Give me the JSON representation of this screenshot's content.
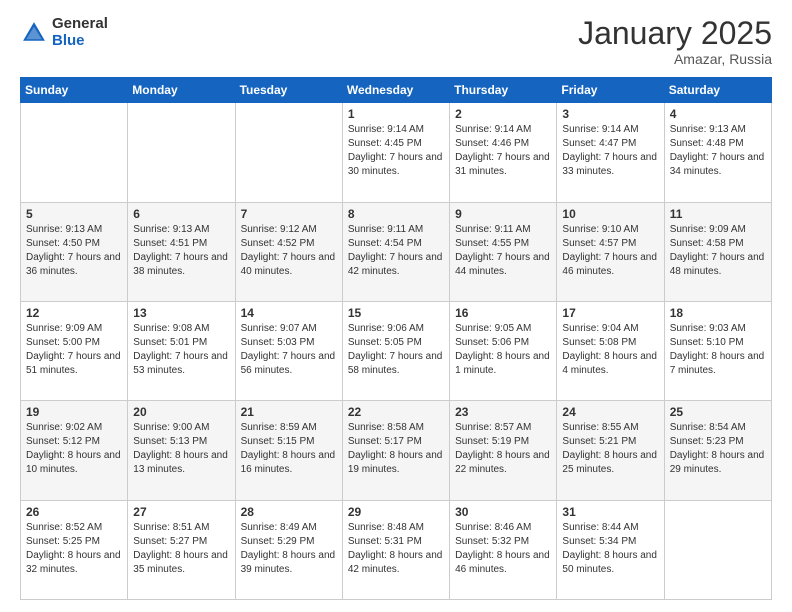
{
  "logo": {
    "general": "General",
    "blue": "Blue"
  },
  "header": {
    "month": "January 2025",
    "location": "Amazar, Russia"
  },
  "weekdays": [
    "Sunday",
    "Monday",
    "Tuesday",
    "Wednesday",
    "Thursday",
    "Friday",
    "Saturday"
  ],
  "weeks": [
    [
      {
        "day": "",
        "info": ""
      },
      {
        "day": "",
        "info": ""
      },
      {
        "day": "",
        "info": ""
      },
      {
        "day": "1",
        "info": "Sunrise: 9:14 AM\nSunset: 4:45 PM\nDaylight: 7 hours\nand 30 minutes."
      },
      {
        "day": "2",
        "info": "Sunrise: 9:14 AM\nSunset: 4:46 PM\nDaylight: 7 hours\nand 31 minutes."
      },
      {
        "day": "3",
        "info": "Sunrise: 9:14 AM\nSunset: 4:47 PM\nDaylight: 7 hours\nand 33 minutes."
      },
      {
        "day": "4",
        "info": "Sunrise: 9:13 AM\nSunset: 4:48 PM\nDaylight: 7 hours\nand 34 minutes."
      }
    ],
    [
      {
        "day": "5",
        "info": "Sunrise: 9:13 AM\nSunset: 4:50 PM\nDaylight: 7 hours\nand 36 minutes."
      },
      {
        "day": "6",
        "info": "Sunrise: 9:13 AM\nSunset: 4:51 PM\nDaylight: 7 hours\nand 38 minutes."
      },
      {
        "day": "7",
        "info": "Sunrise: 9:12 AM\nSunset: 4:52 PM\nDaylight: 7 hours\nand 40 minutes."
      },
      {
        "day": "8",
        "info": "Sunrise: 9:11 AM\nSunset: 4:54 PM\nDaylight: 7 hours\nand 42 minutes."
      },
      {
        "day": "9",
        "info": "Sunrise: 9:11 AM\nSunset: 4:55 PM\nDaylight: 7 hours\nand 44 minutes."
      },
      {
        "day": "10",
        "info": "Sunrise: 9:10 AM\nSunset: 4:57 PM\nDaylight: 7 hours\nand 46 minutes."
      },
      {
        "day": "11",
        "info": "Sunrise: 9:09 AM\nSunset: 4:58 PM\nDaylight: 7 hours\nand 48 minutes."
      }
    ],
    [
      {
        "day": "12",
        "info": "Sunrise: 9:09 AM\nSunset: 5:00 PM\nDaylight: 7 hours\nand 51 minutes."
      },
      {
        "day": "13",
        "info": "Sunrise: 9:08 AM\nSunset: 5:01 PM\nDaylight: 7 hours\nand 53 minutes."
      },
      {
        "day": "14",
        "info": "Sunrise: 9:07 AM\nSunset: 5:03 PM\nDaylight: 7 hours\nand 56 minutes."
      },
      {
        "day": "15",
        "info": "Sunrise: 9:06 AM\nSunset: 5:05 PM\nDaylight: 7 hours\nand 58 minutes."
      },
      {
        "day": "16",
        "info": "Sunrise: 9:05 AM\nSunset: 5:06 PM\nDaylight: 8 hours\nand 1 minute."
      },
      {
        "day": "17",
        "info": "Sunrise: 9:04 AM\nSunset: 5:08 PM\nDaylight: 8 hours\nand 4 minutes."
      },
      {
        "day": "18",
        "info": "Sunrise: 9:03 AM\nSunset: 5:10 PM\nDaylight: 8 hours\nand 7 minutes."
      }
    ],
    [
      {
        "day": "19",
        "info": "Sunrise: 9:02 AM\nSunset: 5:12 PM\nDaylight: 8 hours\nand 10 minutes."
      },
      {
        "day": "20",
        "info": "Sunrise: 9:00 AM\nSunset: 5:13 PM\nDaylight: 8 hours\nand 13 minutes."
      },
      {
        "day": "21",
        "info": "Sunrise: 8:59 AM\nSunset: 5:15 PM\nDaylight: 8 hours\nand 16 minutes."
      },
      {
        "day": "22",
        "info": "Sunrise: 8:58 AM\nSunset: 5:17 PM\nDaylight: 8 hours\nand 19 minutes."
      },
      {
        "day": "23",
        "info": "Sunrise: 8:57 AM\nSunset: 5:19 PM\nDaylight: 8 hours\nand 22 minutes."
      },
      {
        "day": "24",
        "info": "Sunrise: 8:55 AM\nSunset: 5:21 PM\nDaylight: 8 hours\nand 25 minutes."
      },
      {
        "day": "25",
        "info": "Sunrise: 8:54 AM\nSunset: 5:23 PM\nDaylight: 8 hours\nand 29 minutes."
      }
    ],
    [
      {
        "day": "26",
        "info": "Sunrise: 8:52 AM\nSunset: 5:25 PM\nDaylight: 8 hours\nand 32 minutes."
      },
      {
        "day": "27",
        "info": "Sunrise: 8:51 AM\nSunset: 5:27 PM\nDaylight: 8 hours\nand 35 minutes."
      },
      {
        "day": "28",
        "info": "Sunrise: 8:49 AM\nSunset: 5:29 PM\nDaylight: 8 hours\nand 39 minutes."
      },
      {
        "day": "29",
        "info": "Sunrise: 8:48 AM\nSunset: 5:31 PM\nDaylight: 8 hours\nand 42 minutes."
      },
      {
        "day": "30",
        "info": "Sunrise: 8:46 AM\nSunset: 5:32 PM\nDaylight: 8 hours\nand 46 minutes."
      },
      {
        "day": "31",
        "info": "Sunrise: 8:44 AM\nSunset: 5:34 PM\nDaylight: 8 hours\nand 50 minutes."
      },
      {
        "day": "",
        "info": ""
      }
    ]
  ]
}
